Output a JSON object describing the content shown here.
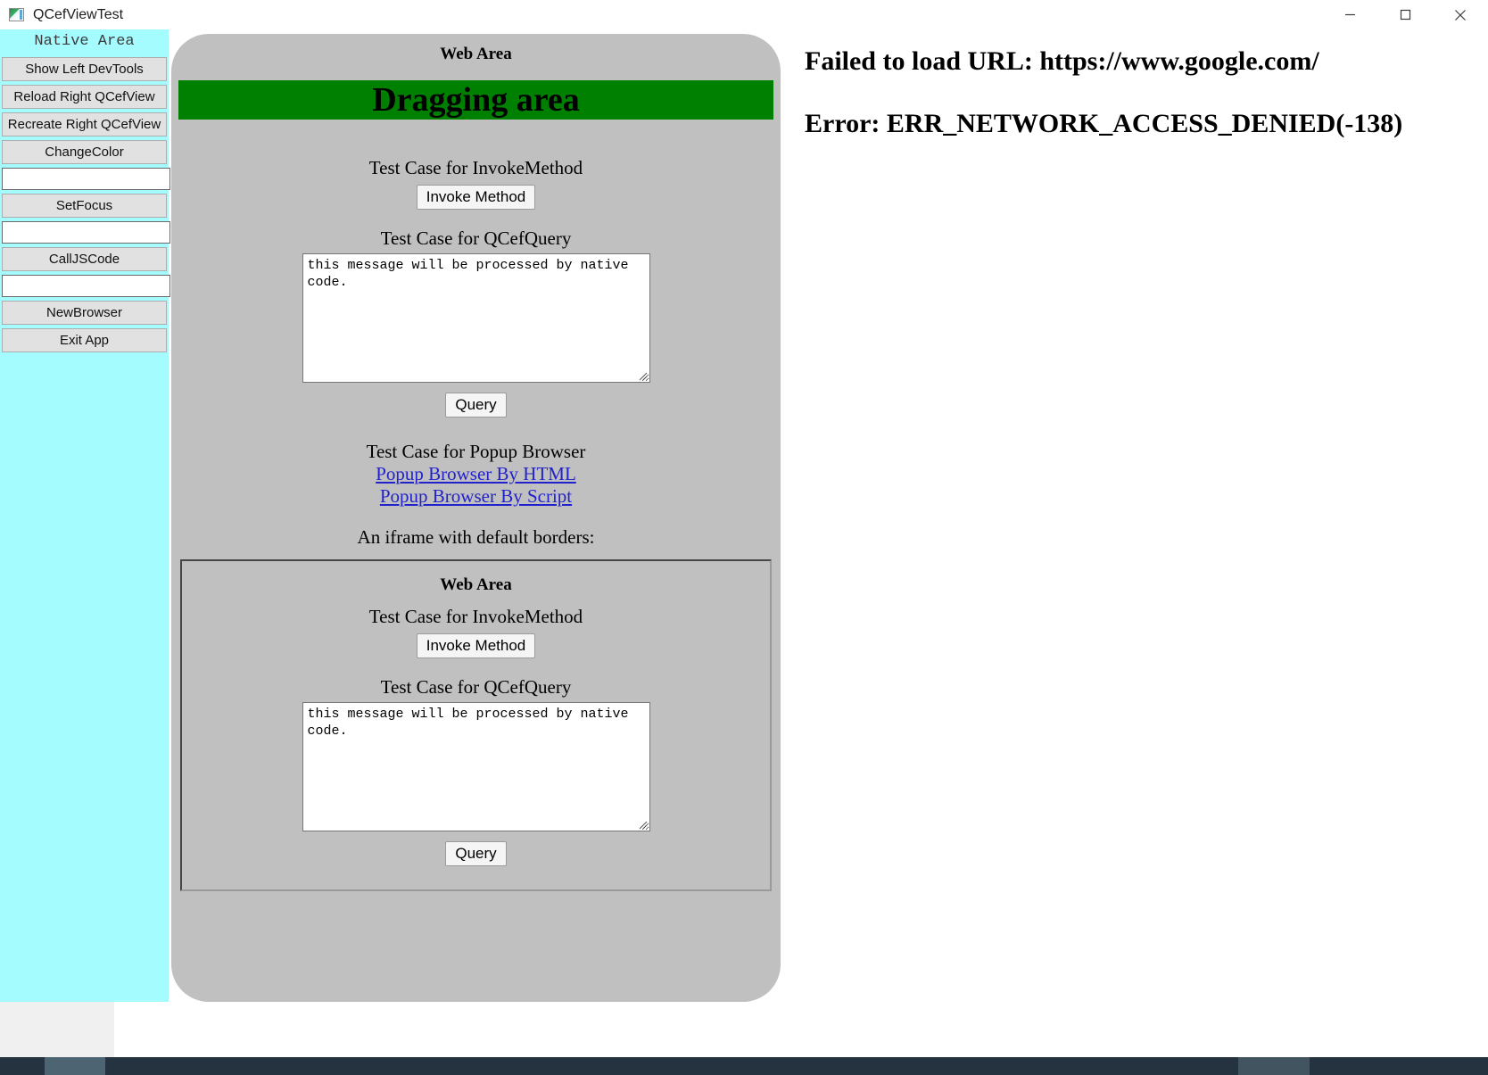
{
  "window": {
    "title": "QCefViewTest",
    "icon": "app-icon",
    "controls": {
      "minimize": "minimize-icon",
      "maximize": "maximize-icon",
      "close": "close-icon"
    }
  },
  "native_area": {
    "title": "Native Area",
    "buttons": [
      {
        "label": "Show Left DevTools"
      },
      {
        "label": "Reload Right QCefView"
      },
      {
        "label": "Recreate Right QCefView"
      },
      {
        "label": "ChangeColor"
      },
      {
        "label": "SetFocus"
      },
      {
        "label": "CallJSCode"
      },
      {
        "label": "NewBrowser"
      },
      {
        "label": "Exit App"
      }
    ],
    "inputs": [
      {
        "value": "",
        "placeholder": ""
      },
      {
        "value": "",
        "placeholder": ""
      },
      {
        "value": "",
        "placeholder": ""
      }
    ],
    "bg_color": "#a5fcff"
  },
  "web_area": {
    "heading": "Web Area",
    "dragging_area": {
      "label": "Dragging area",
      "bg_color": "#008000"
    },
    "invoke_method": {
      "case_label": "Test Case for InvokeMethod",
      "button_label": "Invoke Method"
    },
    "qcef_query": {
      "case_label": "Test Case for QCefQuery",
      "textarea_value": "this message will be processed by native code.",
      "button_label": "Query"
    },
    "popup_browser": {
      "case_label": "Test Case for Popup Browser",
      "links": [
        {
          "label": "Popup Browser By HTML"
        },
        {
          "label": "Popup Browser By Script"
        }
      ],
      "link_color": "#2222cc"
    },
    "iframe_note": "An iframe with default borders:",
    "iframe": {
      "heading": "Web Area",
      "invoke_method": {
        "case_label": "Test Case for InvokeMethod",
        "button_label": "Invoke Method"
      },
      "qcef_query": {
        "case_label": "Test Case for QCefQuery",
        "textarea_value": "this message will be processed by native code.",
        "button_label": "Query"
      }
    },
    "bg_color": "#c0c0c0"
  },
  "right_panel": {
    "error_url_line": "Failed to load URL: https://www.google.com/",
    "error_code_line": "Error: ERR_NETWORK_ACCESS_DENIED(-138)"
  }
}
